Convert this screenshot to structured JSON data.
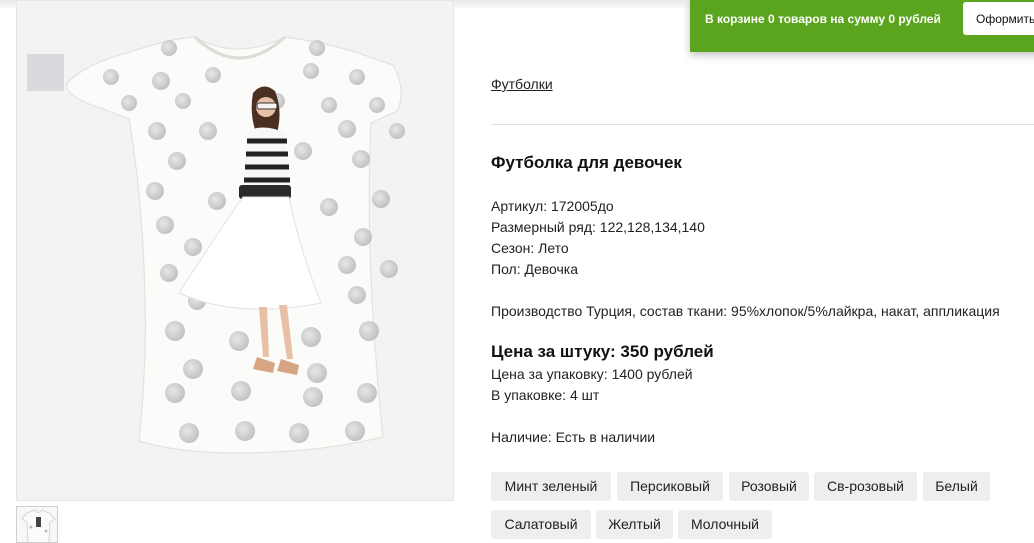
{
  "cart": {
    "text_prefix": "В корзине ",
    "count": "0",
    "text_middle": " товаров на сумму ",
    "sum": "0",
    "text_suffix": " рублей",
    "checkout_label": "Оформить"
  },
  "product": {
    "breadcrumb": "Футболки",
    "title": "Футболка для девочек",
    "specs": [
      "Артикул: 172005до",
      "Размерный ряд: 122,128,134,140",
      "Сезон: Лето",
      "Пол: Девочка"
    ],
    "description": "Производство Турция, состав ткани: 95%хлопок/5%лайкра, накат, аппликация",
    "price_per_item": "Цена за штуку: 350 рублей",
    "price_per_pack": "Цена за упаковку: 1400 рублей",
    "pack_size": "В упаковке: 4 шт",
    "availability": "Наличие: Есть в наличии",
    "colors": [
      "Минт зеленый",
      "Персиковый",
      "Розовый",
      "Св-розовый",
      "Белый",
      "Салатовый",
      "Желтый",
      "Молочный"
    ]
  },
  "colors": {
    "cart_bar": "#5aa51d",
    "chip_bg": "#eeeeee"
  }
}
